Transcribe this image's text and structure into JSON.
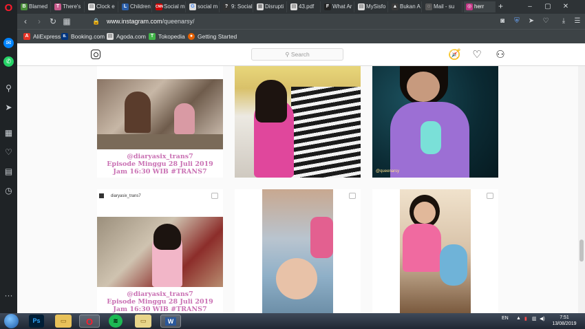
{
  "tabs": [
    {
      "label": "Blamed",
      "color": "#4a8f3a",
      "glyph": "B"
    },
    {
      "label": "There's",
      "color": "#c85a8c",
      "glyph": "T"
    },
    {
      "label": "Clock e",
      "color": "#eeeeee",
      "glyph": "▤"
    },
    {
      "label": "Children",
      "color": "#2b5ea8",
      "glyph": "L"
    },
    {
      "label": "Social m",
      "color": "#cc0000",
      "glyph": "CNN"
    },
    {
      "label": "social m",
      "color": "#dddddd",
      "glyph": "G"
    },
    {
      "label": "9: Social",
      "color": "#333333",
      "glyph": "?"
    },
    {
      "label": "Disrupti",
      "color": "#dddddd",
      "glyph": "▦"
    },
    {
      "label": "43.pdf",
      "color": "#dddddd",
      "glyph": "▤"
    },
    {
      "label": "What Ar",
      "color": "#222222",
      "glyph": "F"
    },
    {
      "label": "MySisfo",
      "color": "#dddddd",
      "glyph": "▤"
    },
    {
      "label": "Bukan A",
      "color": "#3a3a3a",
      "glyph": "▲"
    },
    {
      "label": "Mail - su",
      "color": "#555555",
      "glyph": "◌"
    },
    {
      "label": "herr",
      "color": "#c13584",
      "glyph": "◎"
    }
  ],
  "addressbar": {
    "url_host": "www.instagram.com",
    "url_path": "/queenarsy/"
  },
  "bookmarks": [
    {
      "label": "AliExpress",
      "color": "#e43225",
      "glyph": "A"
    },
    {
      "label": "Booking.com",
      "color": "#003580",
      "glyph": "B."
    },
    {
      "label": "Agoda.com",
      "color": "#dddddd",
      "glyph": "▤"
    },
    {
      "label": "Tokopedia",
      "color": "#42b549",
      "glyph": "T"
    },
    {
      "label": "Getting Started",
      "color": "#e66000",
      "glyph": "●"
    }
  ],
  "instagram": {
    "search_placeholder": "Search",
    "search_glyph": "⚲"
  },
  "posts": {
    "p1_caption": [
      "@diaryasix_trans7",
      "Episode Minggu 28 Juli 2019",
      "Jam 16:30 WIB #TRANS7"
    ],
    "p3_watermark": "@queenarsy",
    "p4_account": "diaryasix_trans7",
    "p4_caption": [
      "@diaryasix_trans7",
      "Episode Minggu 28 Juli 2019",
      "Jam 16:30 WIB #TRANS7"
    ]
  },
  "taskbar": {
    "lang": "EN",
    "time": "7:51",
    "date": "13/08/2019"
  },
  "colors": {
    "caption_pink": "#c970b3",
    "opera_red": "#ff1b2d"
  }
}
